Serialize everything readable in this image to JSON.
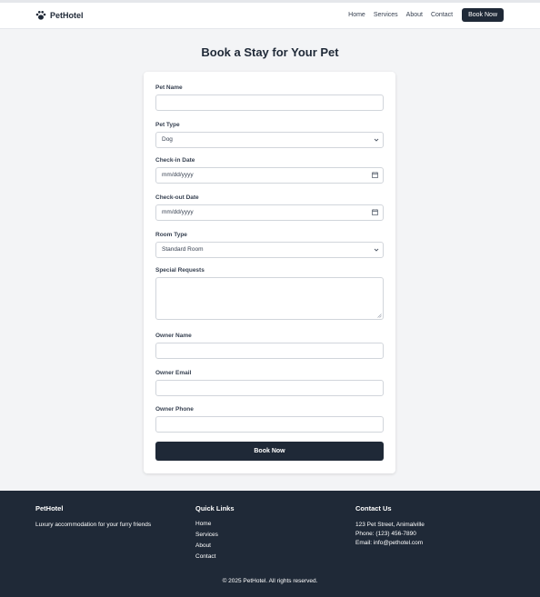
{
  "header": {
    "brand": "PetHotel",
    "nav": [
      "Home",
      "Services",
      "About",
      "Contact"
    ],
    "cta": "Book Now"
  },
  "title": "Book a Stay for Your Pet",
  "form": {
    "pet_name": {
      "label": "Pet Name",
      "value": ""
    },
    "pet_type": {
      "label": "Pet Type",
      "value": "Dog"
    },
    "check_in": {
      "label": "Check-in Date",
      "value": "mm/dd/yyyy"
    },
    "check_out": {
      "label": "Check-out Date",
      "value": "mm/dd/yyyy"
    },
    "room_type": {
      "label": "Room Type",
      "value": "Standard Room"
    },
    "special_requests": {
      "label": "Special Requests",
      "value": ""
    },
    "owner_name": {
      "label": "Owner Name",
      "value": ""
    },
    "owner_email": {
      "label": "Owner Email",
      "value": ""
    },
    "owner_phone": {
      "label": "Owner Phone",
      "value": ""
    },
    "submit_label": "Book Now"
  },
  "footer": {
    "brand": {
      "title": "PetHotel",
      "tagline": "Luxury accommodation for your furry friends"
    },
    "quick_links": {
      "title": "Quick Links",
      "items": [
        "Home",
        "Services",
        "About",
        "Contact"
      ]
    },
    "contact": {
      "title": "Contact Us",
      "address": "123 Pet Street, Animalville",
      "phone": "Phone: (123) 456-7890",
      "email": "Email: info@pethotel.com"
    },
    "copyright": "© 2025 PetHotel. All rights reserved."
  }
}
